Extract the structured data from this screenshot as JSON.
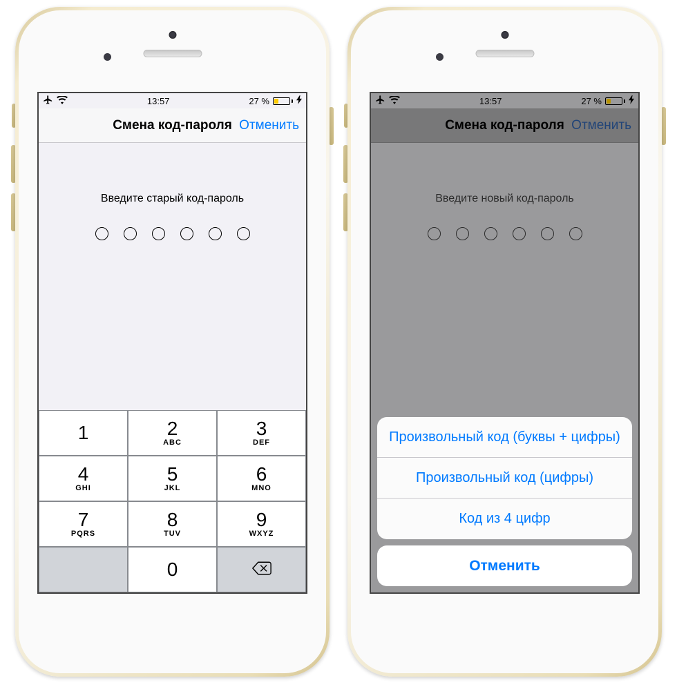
{
  "status": {
    "time": "13:57",
    "battery_pct": "27 %"
  },
  "nav": {
    "title": "Смена код-пароля",
    "cancel": "Отменить"
  },
  "left": {
    "prompt": "Введите старый код-пароль"
  },
  "right": {
    "prompt": "Введите новый код-пароль"
  },
  "keypad": {
    "keys": [
      {
        "num": "1",
        "letters": ""
      },
      {
        "num": "2",
        "letters": "ABC"
      },
      {
        "num": "3",
        "letters": "DEF"
      },
      {
        "num": "4",
        "letters": "GHI"
      },
      {
        "num": "5",
        "letters": "JKL"
      },
      {
        "num": "6",
        "letters": "MNO"
      },
      {
        "num": "7",
        "letters": "PQRS"
      },
      {
        "num": "8",
        "letters": "TUV"
      },
      {
        "num": "9",
        "letters": "WXYZ"
      },
      {
        "num": "0",
        "letters": ""
      }
    ]
  },
  "sheet": {
    "option1": "Произвольный код (буквы + цифры)",
    "option2": "Произвольный код (цифры)",
    "option3": "Код из 4 цифр",
    "cancel": "Отменить"
  }
}
